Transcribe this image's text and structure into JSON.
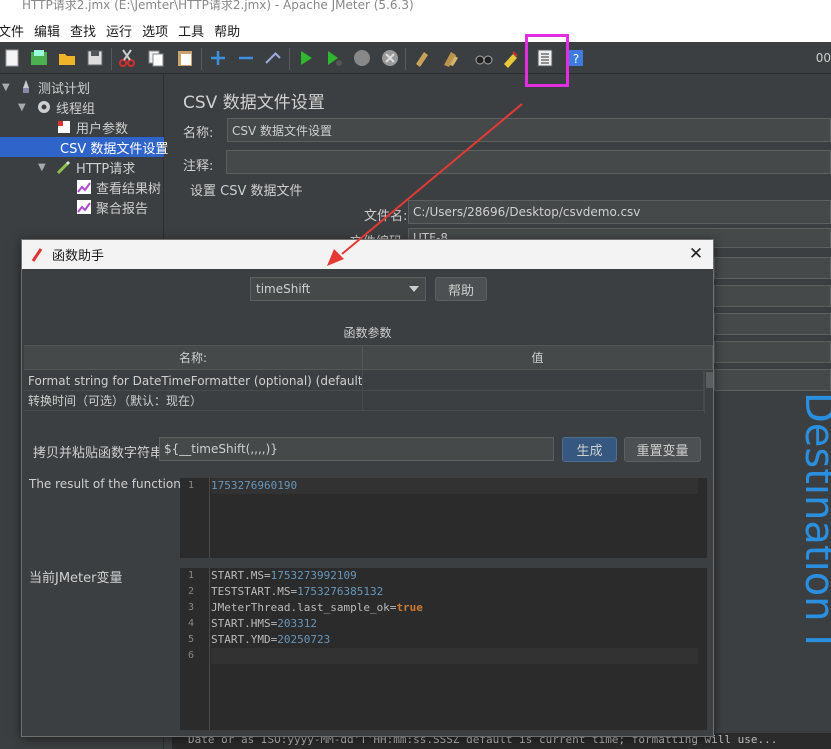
{
  "window": {
    "title": "HTTP请求2.jmx (E:\\Jemter\\HTTP请求2.jmx) - Apache JMeter (5.6.3)"
  },
  "menu": [
    "文件",
    "编辑",
    "查找",
    "运行",
    "选项",
    "工具",
    "帮助"
  ],
  "toolbar": {
    "right_text": "00"
  },
  "tree": [
    {
      "label": "测试计划",
      "icon": "test-plan-icon"
    },
    {
      "label": "线程组",
      "icon": "gear-icon"
    },
    {
      "label": "用户参数",
      "icon": "user-params-icon"
    },
    {
      "label": "CSV 数据文件设置",
      "icon": "scissors-icon",
      "selected": true
    },
    {
      "label": "HTTP请求",
      "icon": "pipette-icon"
    },
    {
      "label": "查看结果树",
      "icon": "graph-icon"
    },
    {
      "label": "聚合报告",
      "icon": "graph-icon"
    }
  ],
  "panel": {
    "title": "CSV 数据文件设置",
    "name_label": "名称:",
    "name_value": "CSV 数据文件设置",
    "comment_label": "注释:",
    "comment_value": "",
    "section_label": "设置 CSV 数据文件",
    "filename_label": "文件名:",
    "filename_value": "C:/Users/28696/Desktop/csvdemo.csv",
    "encoding_label": "文件编码",
    "encoding_value": "UTF-8"
  },
  "overlay": {
    "vertical_text": "Destination I"
  },
  "bottom_code": "Date or as ISO:yyyy-MM-dd'T'HH:mm:ss.SSSZ  default is current time; formatting will use...",
  "dialog": {
    "title": "函数助手",
    "selected_function": "timeShift",
    "help_button": "帮助",
    "params_title": "函数参数",
    "columns": [
      "名称:",
      "值"
    ],
    "rows": [
      {
        "name": "Format string for DateTimeFormatter (optional) (default unix...",
        "value": ""
      },
      {
        "name": "转换时间（可选）（默认：现在）",
        "value": ""
      }
    ],
    "copy_label": "拷贝并粘贴函数字符串",
    "function_string": "${__timeShift(,,,,)}",
    "generate_button": "生成",
    "reset_button": "重置变量",
    "result_label": "The result of the function is",
    "result_lines": [
      "1753276960190"
    ],
    "vars_label": "当前JMeter变量",
    "vars_lines": [
      {
        "key": "START.MS=",
        "value": "1753273992109"
      },
      {
        "key": "TESTSTART.MS=",
        "value": "1753276385132"
      },
      {
        "key": "JMeterThread.last_sample_ok=",
        "value": "true"
      },
      {
        "key": "START.HMS=",
        "value": "203312"
      },
      {
        "key": "START.YMD=",
        "value": "20250723"
      },
      {
        "key": "",
        "value": ""
      }
    ]
  },
  "colors": {
    "highlight": "#e02ee0",
    "arrow": "#e53935",
    "selection": "#2f65ca",
    "accent": "#2b8fe0"
  }
}
